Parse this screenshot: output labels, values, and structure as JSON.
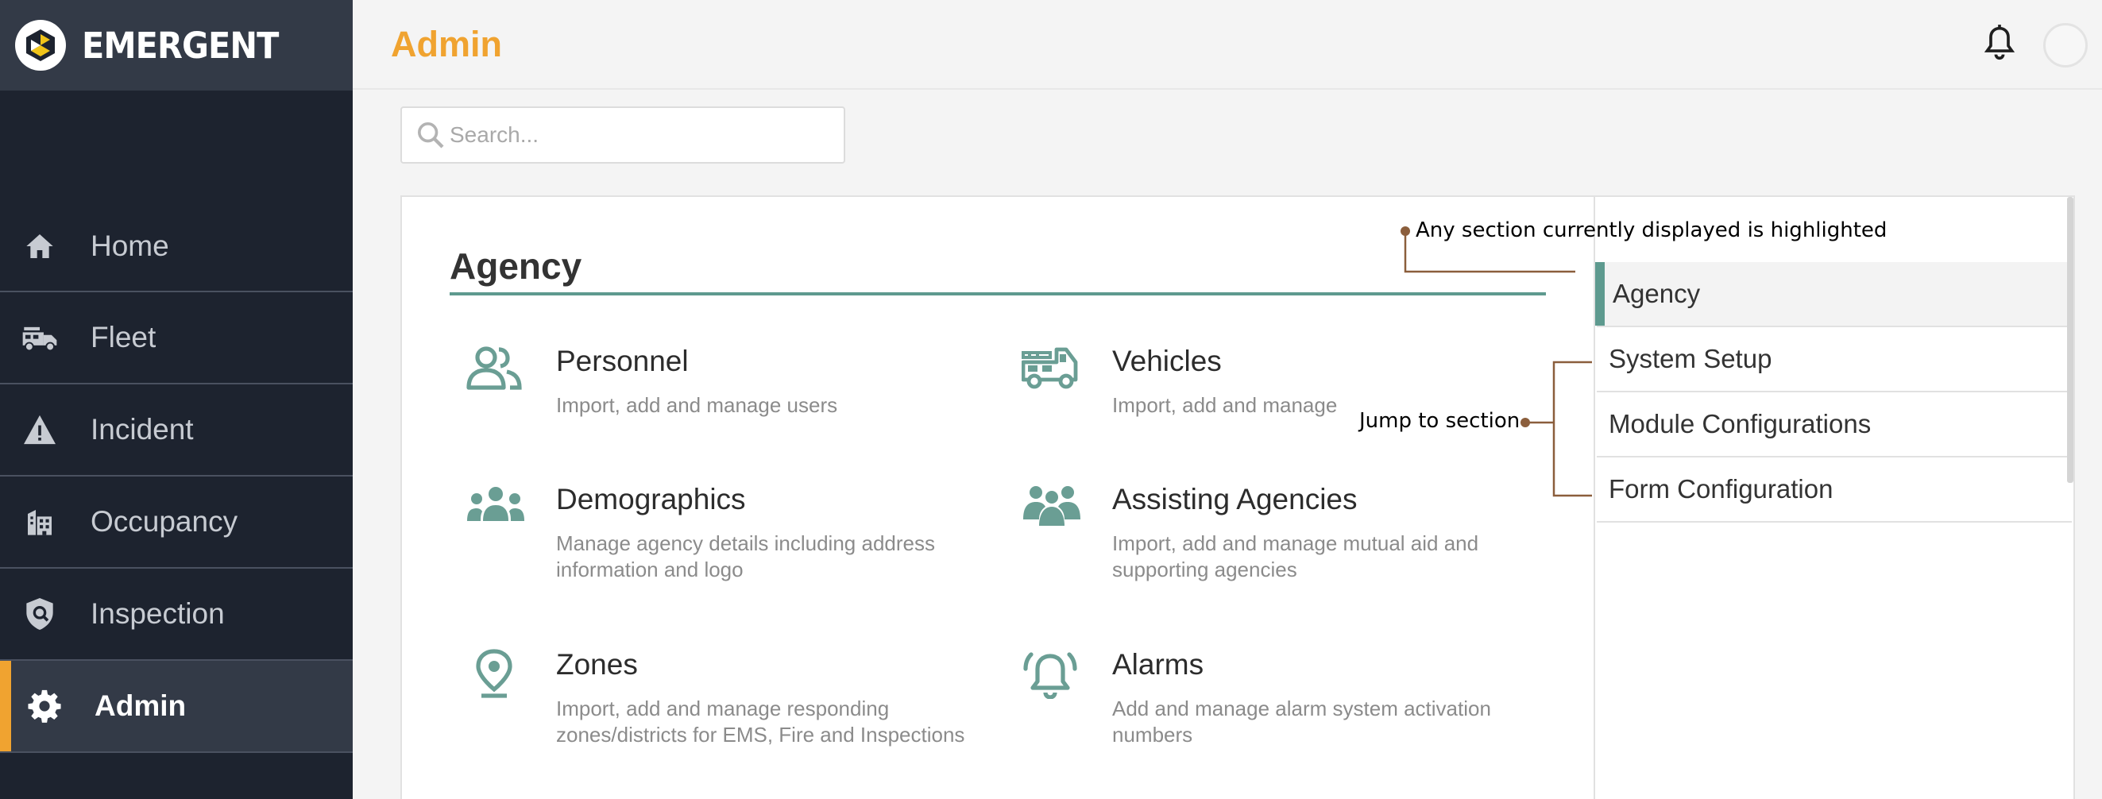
{
  "brand": {
    "name": "EMERGENT"
  },
  "sidebar": {
    "items": [
      {
        "label": "Home",
        "icon": "home-icon"
      },
      {
        "label": "Fleet",
        "icon": "fire-truck-icon"
      },
      {
        "label": "Incident",
        "icon": "warning-icon"
      },
      {
        "label": "Occupancy",
        "icon": "building-icon"
      },
      {
        "label": "Inspection",
        "icon": "shield-search-icon"
      },
      {
        "label": "Admin",
        "icon": "gear-icon",
        "active": true
      }
    ]
  },
  "header": {
    "title": "Admin"
  },
  "search": {
    "placeholder": "Search..."
  },
  "section": {
    "title": "Agency",
    "tiles": [
      {
        "title": "Personnel",
        "description": "Import, add and manage users",
        "icon": "users-icon"
      },
      {
        "title": "Vehicles",
        "description": "Import, add and manage",
        "icon": "fire-truck-icon"
      },
      {
        "title": "Demographics",
        "description": "Manage agency details including address information and logo",
        "icon": "group-icon"
      },
      {
        "title": "Assisting Agencies",
        "description": "Import, add and manage mutual aid and supporting agencies",
        "icon": "people-group-icon"
      },
      {
        "title": "Zones",
        "description": "Import, add and manage responding zones/districts for EMS, Fire and Inspections",
        "icon": "location-pin-icon"
      },
      {
        "title": "Alarms",
        "description": "Add and manage alarm system activation numbers",
        "icon": "alarm-bell-icon"
      }
    ]
  },
  "jump_panel": {
    "items": [
      {
        "label": "Agency",
        "active": true
      },
      {
        "label": "System Setup"
      },
      {
        "label": "Module Configurations"
      },
      {
        "label": "Form Configuration"
      }
    ]
  },
  "annotations": {
    "highlight": "Any section currently displayed is highlighted",
    "jump": "Jump to section"
  },
  "colors": {
    "sidebar_bg": "#1d232f",
    "accent_orange": "#f0a330",
    "accent_teal": "#5e9a8f",
    "annotation_line": "#8b5e3c"
  }
}
